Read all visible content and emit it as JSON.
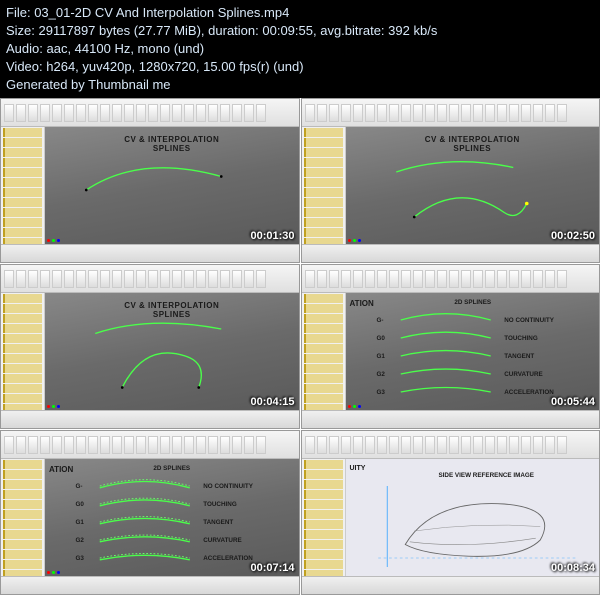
{
  "header": {
    "file_label": "File:",
    "file_value": "03_01-2D CV And Interpolation Splines.mp4",
    "size_label": "Size:",
    "size_bytes": "29117897 bytes",
    "size_mib": "(27.77 MiB)",
    "duration_label": "duration:",
    "duration_value": "00:09:55",
    "bitrate_label": "avg.bitrate:",
    "bitrate_value": "392 kb/s",
    "audio_label": "Audio:",
    "audio_value": "aac, 44100 Hz, mono (und)",
    "video_label": "Video:",
    "video_value": "h264, yuv420p, 1280x720, 15.00 fps(r) (und)",
    "generated": "Generated by Thumbnail me"
  },
  "thumbs": [
    {
      "timestamp": "00:01:30",
      "title": "CV & INTERPOLATION\nSPLINES",
      "kind": "spline1"
    },
    {
      "timestamp": "00:02:50",
      "title": "CV & INTERPOLATION\nSPLINES",
      "kind": "spline2"
    },
    {
      "timestamp": "00:04:15",
      "title": "CV & INTERPOLATION\nSPLINES",
      "kind": "spline3"
    },
    {
      "timestamp": "00:05:44",
      "title": "2D SPLINES",
      "kind": "legend"
    },
    {
      "timestamp": "00:07:14",
      "title": "2D SPLINES",
      "kind": "legend-dashed"
    },
    {
      "timestamp": "00:08:34",
      "title": "SIDE VIEW REFERENCE IMAGE",
      "kind": "reference"
    }
  ],
  "legend": {
    "rows": [
      {
        "g": "G-",
        "label": "NO CONTINUITY"
      },
      {
        "g": "G0",
        "label": "TOUCHING"
      },
      {
        "g": "G1",
        "label": "TANGENT"
      },
      {
        "g": "G2",
        "label": "CURVATURE"
      },
      {
        "g": "G3",
        "label": "ACCELERATION"
      }
    ]
  },
  "partial_legend": {
    "suffix": "ATION",
    "labels": [
      "UITY"
    ]
  }
}
